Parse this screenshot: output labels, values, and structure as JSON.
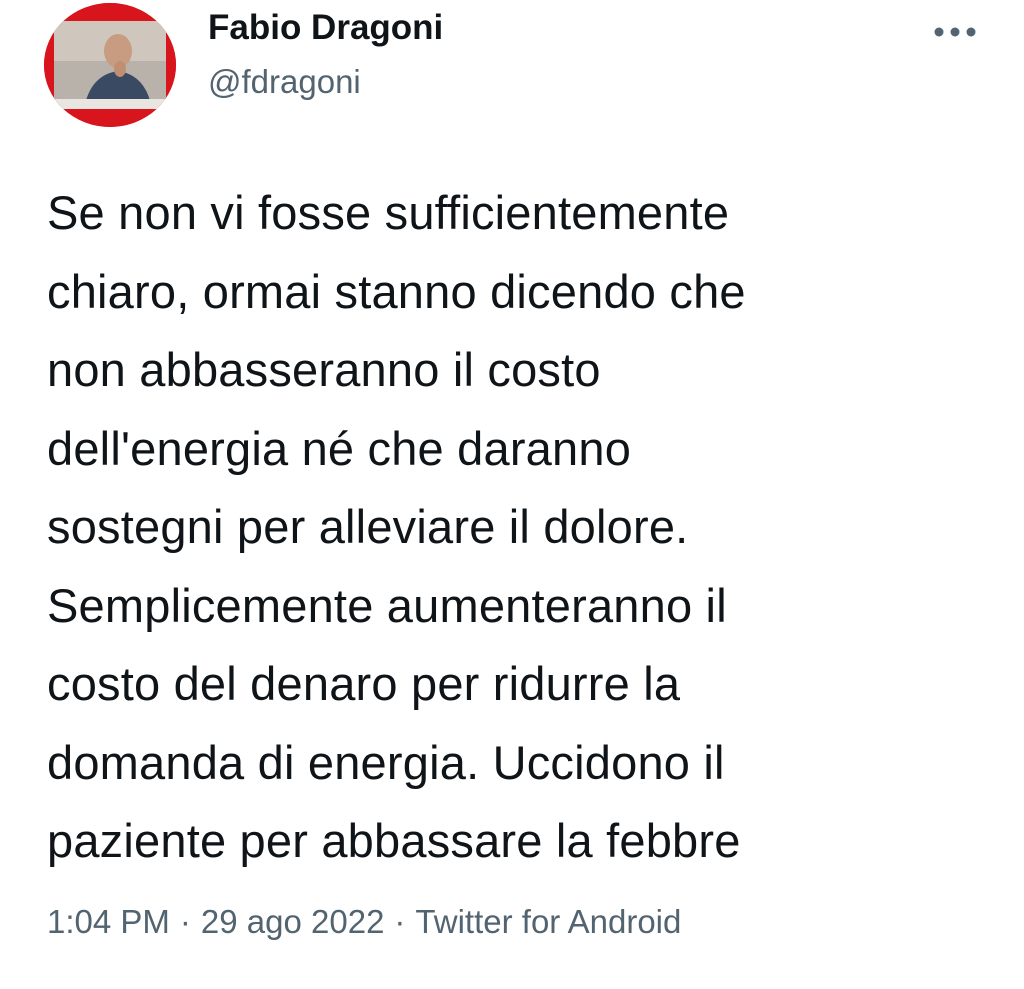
{
  "author": {
    "name": "Fabio Dragoni",
    "handle": "@fdragoni"
  },
  "tweet": {
    "text": "Se non vi fosse sufficientemente\nchiaro, ormai stanno dicendo che\nnon abbasseranno il costo\ndell'energia né che daranno\nsostegni per alleviare il dolore.\nSemplicemente aumenteranno il\ncosto del denaro per ridurre la\ndomanda di energia. Uccidono il\npaziente per abbassare la febbre"
  },
  "meta": {
    "time": "1:04 PM",
    "separator": "·",
    "date": "29 ago 2022",
    "source": "Twitter for Android"
  },
  "icons": {
    "more": "more-horizontal-icon",
    "avatar": "profile-photo"
  },
  "colors": {
    "text": "#0f1419",
    "secondary": "#536471",
    "avatar_background": "#d8141c"
  }
}
